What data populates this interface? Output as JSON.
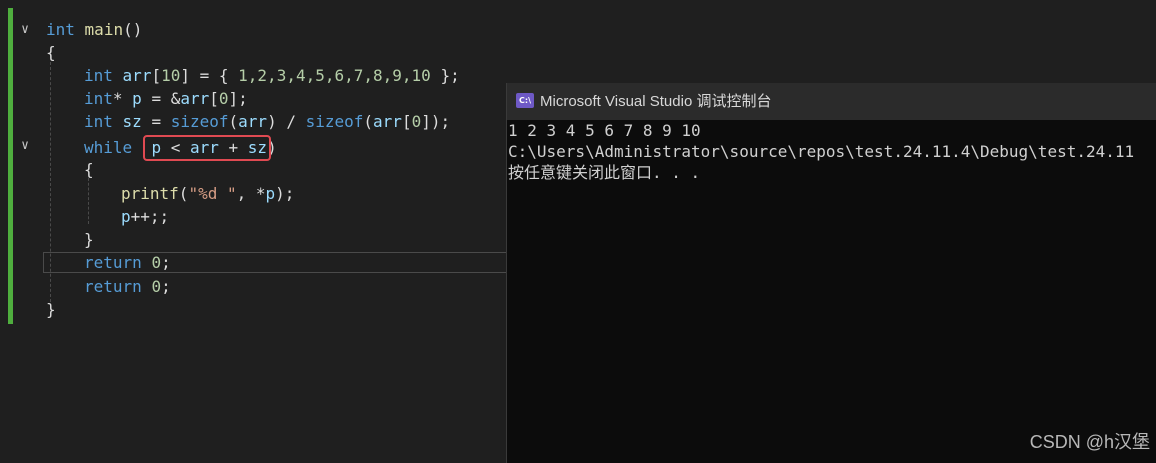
{
  "editor": {
    "lines": {
      "l1": {
        "kw": "int",
        "fn": "main",
        "rest": "()"
      },
      "l2": {
        "text": "{"
      },
      "l3": {
        "kw": "int",
        "var": "arr",
        "b1": "[",
        "n1": "10",
        "b2": "] = { ",
        "nums": "1,2,3,4,5,6,7,8,9,10",
        "end": " };"
      },
      "l4": {
        "kw": "int",
        "star": "* ",
        "var": "p",
        "eq": " = &",
        "var2": "arr",
        "b1": "[",
        "n1": "0",
        "end": "];"
      },
      "l5": {
        "kw": "int",
        "var": "sz",
        "eq": " = ",
        "kw2": "sizeof",
        "p1": "(",
        "var2": "arr",
        "p2": ") / ",
        "kw3": "sizeof",
        "p3": "(",
        "var3": "arr",
        "b1": "[",
        "n1": "0",
        "end": "]);"
      },
      "l6": {
        "kw": "while",
        "sp": "  ",
        "var": "p",
        "op": " < ",
        "var2": "arr",
        "op2": " + ",
        "var3": "sz",
        "end": ")"
      },
      "l7": {
        "text": "{"
      },
      "l8": {
        "fn": "printf",
        "p1": "(",
        "str": "\"%d \"",
        "mid": ", *",
        "var": "p",
        "end": ");"
      },
      "l9": {
        "var": "p",
        "end": "++;;"
      },
      "l10": {
        "text": "}"
      },
      "l11": {
        "kw": "return",
        "num": "0",
        "end": ";"
      },
      "l12": {
        "kw": "return",
        "num": "0",
        "end": ";"
      },
      "l13": {
        "text": "}"
      }
    },
    "fold_icon": "chevron-down"
  },
  "console": {
    "title": "Microsoft Visual Studio 调试控制台",
    "icon_label": "C:\\",
    "output": [
      "1 2 3 4 5 6 7 8 9 10",
      "C:\\Users\\Administrator\\source\\repos\\test.24.11.4\\Debug\\test.24.11",
      "按任意键关闭此窗口. . ."
    ]
  },
  "watermark": "CSDN @h汉堡",
  "colors": {
    "keyword": "#569cd6",
    "variable": "#9cdcfe",
    "function": "#dcdcaa",
    "string": "#d69d85",
    "number": "#b5cea8",
    "highlight_box": "#e04a52",
    "change_bar": "#4fae3e"
  }
}
